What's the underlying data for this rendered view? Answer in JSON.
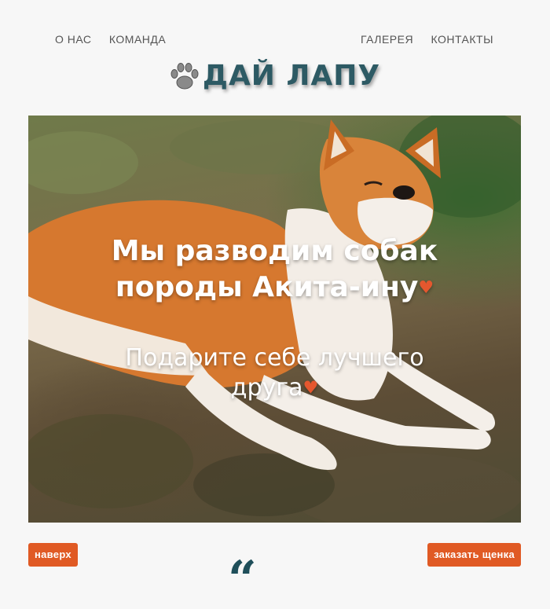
{
  "nav": {
    "left": [
      "О НАС",
      "КОМАНДА"
    ],
    "right": [
      "ГАЛЕРЕЯ",
      "КОНТАКТЫ"
    ]
  },
  "logo": {
    "text": "ДАЙ ЛАПУ",
    "icon": "paw-icon"
  },
  "hero": {
    "headline_line1": "Мы разводим собак",
    "headline_line2": "породы Акита-ину",
    "sub_line1": "Подарите себе лучшего",
    "sub_line2": "друга",
    "heart": "♥"
  },
  "buttons": {
    "top": "наверх",
    "order": "заказать щенка"
  },
  "quote_mark": "“",
  "colors": {
    "accent": "#e05a24",
    "brand": "#2d5a64",
    "heart": "#e4572e"
  }
}
